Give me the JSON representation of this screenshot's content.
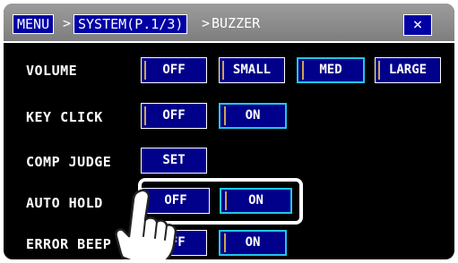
{
  "titlebar": {
    "menu": "MENU",
    "system": "SYSTEM(P.1/3)",
    "sep1": ">",
    "sep2": ">",
    "current": "BUZZER",
    "close": "×"
  },
  "rows": {
    "volume": {
      "label": "VOLUME",
      "options": [
        "OFF",
        "SMALL",
        "MED",
        "LARGE"
      ],
      "selected": "MED"
    },
    "key_click": {
      "label": "KEY CLICK",
      "options": [
        "OFF",
        "ON"
      ],
      "selected": "ON"
    },
    "comp_judge": {
      "label": "COMP JUDGE",
      "options": [
        "SET"
      ]
    },
    "auto_hold": {
      "label": "AUTO HOLD",
      "options": [
        "OFF",
        "ON"
      ],
      "selected": "ON"
    },
    "error_beep": {
      "label": "ERROR BEEP",
      "options": [
        "OFF",
        "ON"
      ],
      "selected": "ON"
    }
  },
  "colors": {
    "button_fill": "#00008a",
    "title_box": "#0000a4",
    "selected_border": "#22c6e8",
    "indicator": "#cfa44e"
  },
  "icons": {
    "pointer": "hand-pointer-icon"
  }
}
